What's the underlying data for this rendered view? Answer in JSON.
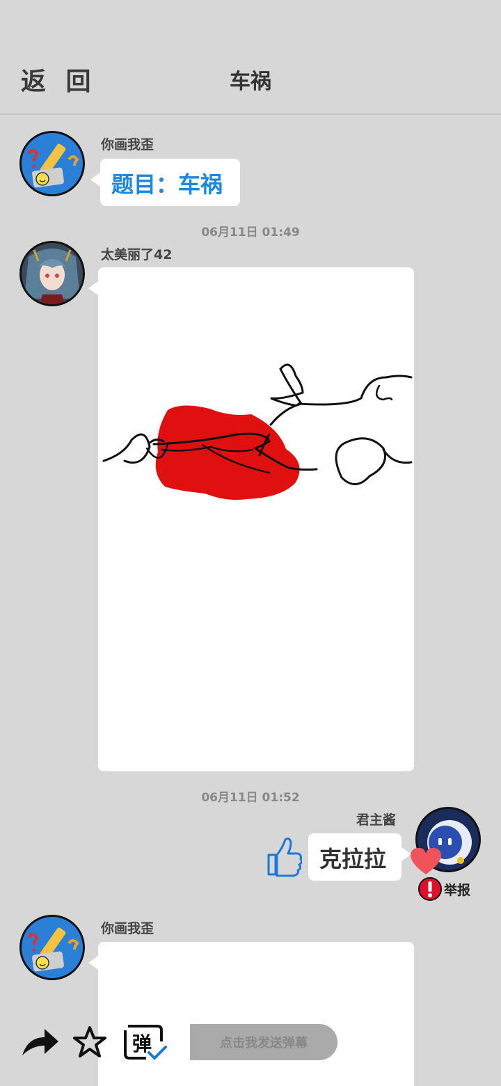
{
  "header": {
    "back_label": "返 回",
    "title": "车祸"
  },
  "messages": [
    {
      "sender": "你画我歪",
      "text": "题目：车祸"
    },
    {
      "time": "06月11日  01:49",
      "sender": "太美丽了42",
      "content_type": "drawing"
    },
    {
      "time": "06月11日  01:52",
      "sender": "君主酱",
      "text": "克拉拉",
      "report_label": "举报"
    },
    {
      "sender": "你画我歪",
      "content_type": "drawing"
    }
  ],
  "toolbar": {
    "danmu_glyph": "弹",
    "danmu_placeholder": "点击我发送弹幕"
  },
  "colors": {
    "background": "#d7d7d7",
    "topic_blue": "#1a88e0",
    "drawing_red": "#e01010",
    "heart": "#f0545a",
    "report_red": "#e0102a"
  },
  "icons": [
    "share-icon",
    "star-icon",
    "danmu-toggle-icon",
    "like-icon",
    "heart-icon",
    "report-icon"
  ]
}
